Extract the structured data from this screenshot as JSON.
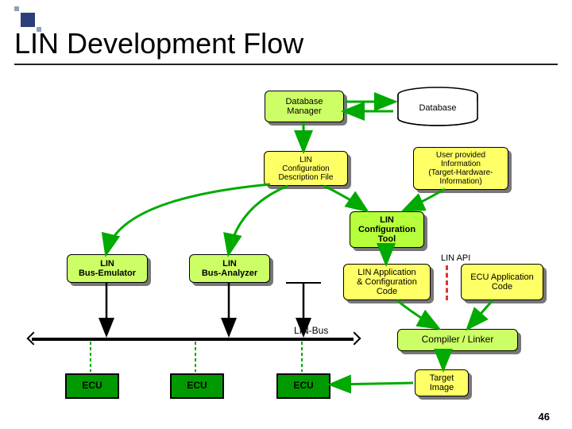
{
  "title": "LIN Development Flow",
  "nodes": {
    "db_manager": "Database\nManager",
    "database": "Database",
    "lin_cfg_desc": "LIN\nConfiguration\nDescription File",
    "user_info": "User provided\nInformation\n(Target-Hardware-\nInformation)",
    "lin_cfg_tool": "LIN\nConfiguration\nTool",
    "lin_emulator": "LIN\nBus-Emulator",
    "lin_analyzer": "LIN\nBus-Analyzer",
    "lin_app_cfg": "LIN Application\n& Configuration\nCode",
    "ecu_app_code": "ECU Application\nCode",
    "lin_api": "LIN API",
    "lin_bus": "LIN-Bus",
    "compiler": "Compiler / Linker",
    "ecu": "ECU",
    "target_image": "Target\nImage"
  },
  "page_number": "46"
}
